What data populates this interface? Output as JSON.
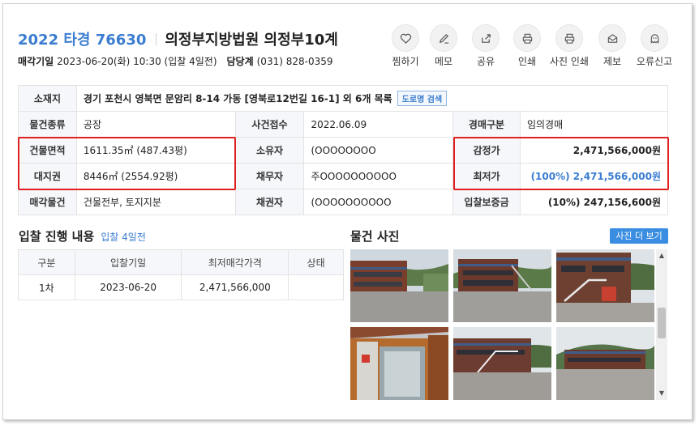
{
  "case": {
    "number": "2022 타경 76630",
    "court": "의정부지방법원 의정부10계"
  },
  "meta": {
    "sale_date_label": "매각기일",
    "sale_date_value": "2023-06-20(화) 10:30 (입찰 4일전)",
    "contact_label": "담당계",
    "contact_value": "(031) 828-0359"
  },
  "actions": [
    {
      "label": "찜하기",
      "icon": "heart-icon"
    },
    {
      "label": "메모",
      "icon": "pencil-icon"
    },
    {
      "label": "공유",
      "icon": "share-icon"
    },
    {
      "label": "인쇄",
      "icon": "printer-icon"
    },
    {
      "label": "사진 인쇄",
      "icon": "printer-icon"
    },
    {
      "label": "제보",
      "icon": "envelope-icon"
    },
    {
      "label": "오류신고",
      "icon": "ghost-icon"
    }
  ],
  "info": {
    "location_label": "소재지",
    "location_value": "경기 포천시 영북면 문암리 8-14 가동 [영북로12번길 16-1] 외 6개 목록",
    "road_search": "도로명 검색",
    "type_label": "물건종류",
    "type_value": "공장",
    "filed_label": "사건접수",
    "filed_value": "2022.06.09",
    "auction_type_label": "경매구분",
    "auction_type_value": "임의경매",
    "building_area_label": "건물면적",
    "building_area_value": "1611.35㎡ (487.43평)",
    "owner_label": "소유자",
    "owner_value": "(OOOOOOOO",
    "appraisal_label": "감정가",
    "appraisal_value": "2,471,566,000원",
    "land_label": "대지권",
    "land_value": "8446㎡ (2554.92평)",
    "debtor_label": "채무자",
    "debtor_value": "주OOOOOOOOOO",
    "min_price_label": "최저가",
    "min_price_value": "(100%) 2,471,566,000원",
    "sale_item_label": "매각물건",
    "sale_item_value": "건물전부, 토지지분",
    "creditor_label": "채권자",
    "creditor_value": "(OOOOOOOOOO",
    "deposit_label": "입찰보증금",
    "deposit_value": "(10%) 247,156,600원"
  },
  "bid_section": {
    "title": "입찰 진행 내용",
    "subtitle": "입찰 4일전",
    "headers": [
      "구분",
      "입찰기일",
      "최저매각가격",
      "상태"
    ],
    "rows": [
      {
        "round": "1차",
        "date": "2023-06-20",
        "price": "2,471,566,000",
        "status": ""
      }
    ]
  },
  "photo_section": {
    "title": "물건 사진",
    "more_button": "사진 더 보기"
  },
  "colors": {
    "accent": "#3a7dd0",
    "highlight_box": "#e02020",
    "header_bg": "#f5f7fa"
  }
}
